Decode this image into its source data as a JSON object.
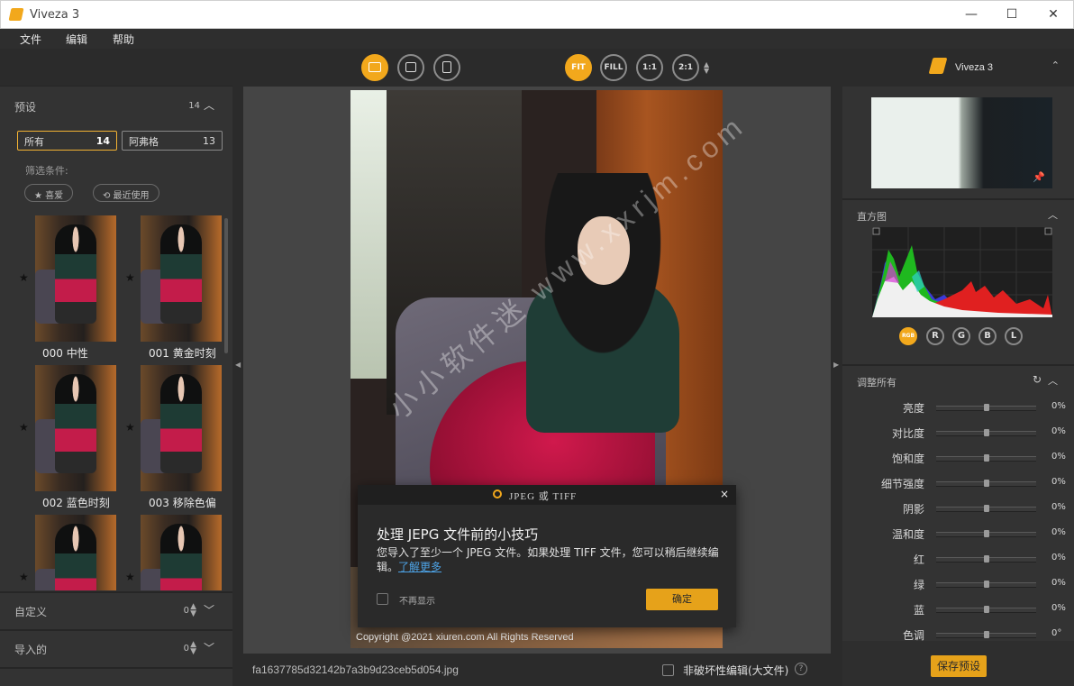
{
  "window": {
    "title": "Viveza 3",
    "minimize": "—",
    "maximize": "☐",
    "close": "✕"
  },
  "menu": {
    "items": [
      "文件",
      "编辑",
      "帮助"
    ]
  },
  "presets": {
    "title": "预设",
    "count": "14",
    "chips": [
      {
        "label": "所有",
        "count": "14"
      },
      {
        "label": "阿弗格",
        "count": "13"
      }
    ],
    "filter_label": "筛选条件:",
    "filters": [
      "★ 喜爱",
      "⟲ 最近使用"
    ],
    "thumbnails": [
      {
        "label": "000 中性"
      },
      {
        "label": "001 黄金时刻"
      },
      {
        "label": "002 蓝色时刻"
      },
      {
        "label": "003 移除色偏"
      },
      {
        "label": ""
      },
      {
        "label": ""
      }
    ]
  },
  "custom": {
    "title": "自定义",
    "count": "0"
  },
  "imported": {
    "title": "导入的",
    "count": "0"
  },
  "toolbar": {
    "zoom": [
      "FIT",
      "FILL",
      "1:1",
      "2:1"
    ]
  },
  "image": {
    "copyright": "Copyright @2021  xiuren.com  All Rights Reserved",
    "watermark": "小小软件迷 www.xxrjm.com"
  },
  "dialog": {
    "header": "JPEG 或 TIFF",
    "title": "处理 JEPG 文件前的小技巧",
    "body": "您导入了至少一个 JPEG 文件。如果处理 TIFF 文件，您可以稍后继续编辑。",
    "link": "了解更多",
    "dont_show": "不再显示",
    "ok": "确定",
    "close": "×"
  },
  "status": {
    "filename": "fa1637785d32142b7a3b9d23ceb5d054.jpg",
    "nondestructive": "非破坏性编辑(大文件)",
    "help": "?"
  },
  "right": {
    "brand": "Viveza 3",
    "histogram_title": "直方图",
    "channels": [
      "RGB",
      "R",
      "G",
      "B",
      "L"
    ],
    "adjust_title": "调整所有",
    "sliders": [
      {
        "label": "亮度",
        "value": "0%",
        "level": 0.5
      },
      {
        "label": "对比度",
        "value": "0%",
        "level": 0.5
      },
      {
        "label": "饱和度",
        "value": "0%",
        "level": 0.5
      },
      {
        "label": "细节强度",
        "value": "0%",
        "level": 0.5
      },
      {
        "label": "阴影",
        "value": "0%",
        "level": 0.5
      },
      {
        "label": "温和度",
        "value": "0%",
        "level": 0.5
      },
      {
        "label": "红",
        "value": "0%",
        "level": 0.5
      },
      {
        "label": "绿",
        "value": "0%",
        "level": 0.5
      },
      {
        "label": "蓝",
        "value": "0%",
        "level": 0.5
      },
      {
        "label": "色调",
        "value": "0°",
        "level": 0.5
      }
    ],
    "save_preset": "保存预设"
  },
  "colors": {
    "accent": "#f2a81c",
    "panel": "#333333",
    "canvas": "#454545"
  }
}
